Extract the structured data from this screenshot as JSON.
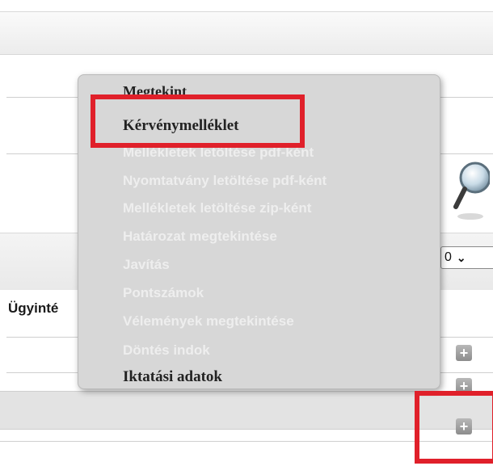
{
  "menu": {
    "items": [
      {
        "label": "Megtekint",
        "enabled": true
      },
      {
        "label": "Kérvénymelléklet",
        "enabled": true
      },
      {
        "label": "Mellékletek letöltése pdf-ként",
        "enabled": false
      },
      {
        "label": "Nyomtatvány letöltése pdf-ként",
        "enabled": false
      },
      {
        "label": "Mellékletek letöltése zip-ként",
        "enabled": false
      },
      {
        "label": "Határozat megtekintése",
        "enabled": false
      },
      {
        "label": "Javítás",
        "enabled": false
      },
      {
        "label": "Pontszámok",
        "enabled": false
      },
      {
        "label": "Vélemények megtekintése",
        "enabled": false
      },
      {
        "label": "Döntés indok",
        "enabled": false
      },
      {
        "label": "Iktatási adatok",
        "enabled": true
      }
    ]
  },
  "table": {
    "column_header": "Ügyinté",
    "page_size_value": "0"
  },
  "icons": {
    "search": "magnifier-icon",
    "expand": "plus-icon",
    "dropdown": "chevron-down-icon"
  },
  "colors": {
    "highlight": "#e0202a",
    "menu_background": "#d7d7d7",
    "disabled_text": "#eeeeee"
  }
}
